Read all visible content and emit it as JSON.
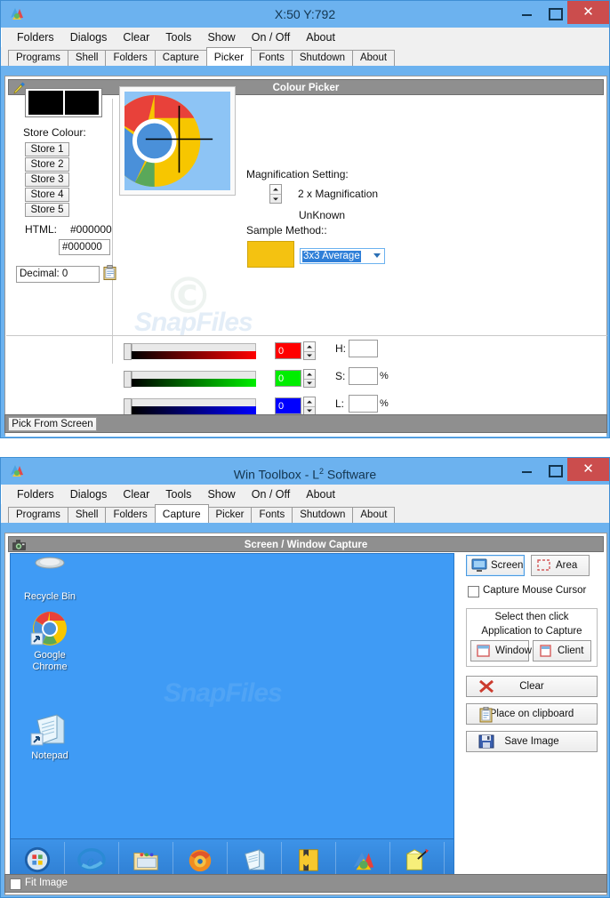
{
  "picker_window": {
    "title": "X:50 Y:792",
    "icon": "app-icon",
    "buttons": {
      "minimize": "–",
      "maximize": "□",
      "close": "✕"
    },
    "menu": [
      "Folders",
      "Dialogs",
      "Clear",
      "Tools",
      "Show",
      "On / Off",
      "About"
    ],
    "tabs": [
      "Programs",
      "Shell",
      "Folders",
      "Capture",
      "Picker",
      "Fonts",
      "Shutdown",
      "About"
    ],
    "active_tab": "Picker",
    "panel_title": "Colour Picker",
    "panel_icon": "eyedropper-icon",
    "store_colour_label": "Store Colour:",
    "store_buttons": [
      "Store 1",
      "Store 2",
      "Store 3",
      "Store 4",
      "Store 5"
    ],
    "html_label": "HTML:",
    "html_value": "#000000",
    "html_field_value": "#000000",
    "decimal_value": "Decimal: 0",
    "copy_icon": "clipboard-icon",
    "swatch_left_color": "#000000",
    "swatch_right_color": "#000000",
    "magnification_label": "Magnification Setting:",
    "magnification_value": "2 x Magnification",
    "unknown_label": "UnKnown",
    "sample_method_label": "Sample Method::",
    "sample_swatch_color": "#f4c211",
    "sample_method_value": "3x3 Average",
    "sliders": [
      {
        "name": "red",
        "value": "0",
        "color": "#ff0000"
      },
      {
        "name": "green",
        "value": "0",
        "color": "#00ee00"
      },
      {
        "name": "blue",
        "value": "0",
        "color": "#0000ff"
      }
    ],
    "hsl": [
      {
        "label": "H:",
        "value": "",
        "unit": ""
      },
      {
        "label": "S:",
        "value": "",
        "unit": "%"
      },
      {
        "label": "L:",
        "value": "",
        "unit": "%"
      }
    ],
    "pick_button": "Pick From Screen",
    "watermark_c": "©",
    "watermark_text": "SnapFiles"
  },
  "capture_window": {
    "title": "Win Toolbox - L",
    "title_sup": "2",
    "title_tail": " Software",
    "icon": "app-icon",
    "buttons": {
      "minimize": "–",
      "maximize": "□",
      "close": "✕"
    },
    "menu": [
      "Folders",
      "Dialogs",
      "Clear",
      "Tools",
      "Show",
      "On / Off",
      "About"
    ],
    "tabs": [
      "Programs",
      "Shell",
      "Folders",
      "Capture",
      "Picker",
      "Fonts",
      "Shutdown",
      "About"
    ],
    "active_tab": "Capture",
    "panel_title": "Screen / Window Capture",
    "panel_icon": "camera-icon",
    "desktop": {
      "background_color": "#3f9bf5",
      "icons": [
        {
          "name": "recycle-bin",
          "label": "Recycle Bin"
        },
        {
          "name": "google-chrome",
          "label": "Google\nChrome"
        },
        {
          "name": "notepad",
          "label": "Notepad"
        }
      ],
      "taskbar_items": [
        "start-orb",
        "internet-explorer",
        "file-explorer",
        "firefox",
        "notepad",
        "winrar",
        "win-toolbox",
        "paint-tool"
      ],
      "watermark_text": "SnapFiles"
    },
    "controls": {
      "screen_button": "Screen",
      "area_button": "Area",
      "capture_cursor_label": "Capture Mouse Cursor",
      "capture_cursor_checked": false,
      "fieldset_line1": "Select then click",
      "fieldset_line2": "Application to Capture",
      "window_button": "Window",
      "client_button": "Client",
      "clear_button": "Clear",
      "clipboard_button": "Place on clipboard",
      "save_button": "Save Image"
    },
    "fit_image_label": "Fit Image",
    "fit_image_checked": false
  }
}
